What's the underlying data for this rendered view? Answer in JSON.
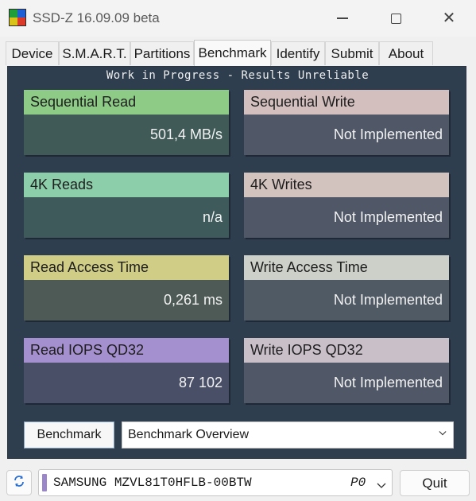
{
  "window": {
    "title": "SSD-Z 16.09.09 beta"
  },
  "tabs": [
    {
      "label": "Device"
    },
    {
      "label": "S.M.A.R.T."
    },
    {
      "label": "Partitions"
    },
    {
      "label": "Benchmark",
      "active": true
    },
    {
      "label": "Identify"
    },
    {
      "label": "Submit"
    },
    {
      "label": "About"
    }
  ],
  "benchmark": {
    "banner": "Work in Progress - Results Unreliable",
    "cards": [
      {
        "label": "Sequential Read",
        "value": "501,4 MB/s",
        "head_color": "#8dcb86",
        "body_color": "#3f5a57"
      },
      {
        "label": "Sequential Write",
        "value": "Not Implemented",
        "head_color": "#d3bfbe",
        "body_color": "#505867"
      },
      {
        "label": "4K Reads",
        "value": "n/a",
        "head_color": "#8ccdaa",
        "body_color": "#3f5a5a"
      },
      {
        "label": "4K Writes",
        "value": "Not Implemented",
        "head_color": "#d3c3bf",
        "body_color": "#505867"
      },
      {
        "label": "Read Access Time",
        "value": "0,261 ms",
        "head_color": "#d0cd87",
        "body_color": "#4e5a55"
      },
      {
        "label": "Write Access Time",
        "value": "Not Implemented",
        "head_color": "#ccd0c8",
        "body_color": "#505a65"
      },
      {
        "label": "Read IOPS QD32",
        "value": "87 102",
        "head_color": "#a590cf",
        "body_color": "#4a4f68"
      },
      {
        "label": "Write IOPS QD32",
        "value": "Not Implemented",
        "head_color": "#c9bfc9",
        "body_color": "#505867"
      }
    ],
    "run_button": "Benchmark",
    "view_select": "Benchmark Overview"
  },
  "footer": {
    "refresh_icon": "refresh-icon",
    "drive_name": "SAMSUNG MZVL81T0HFLB-00BTW",
    "drive_port": "P0",
    "drive_accent": "#9b86c9",
    "quit_label": "Quit"
  }
}
